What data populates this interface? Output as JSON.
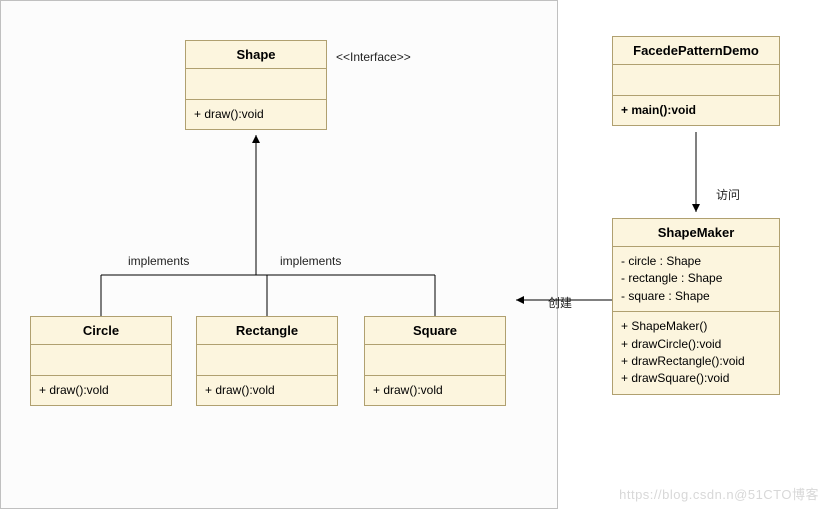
{
  "frame": {
    "present": true
  },
  "stereotype": "<<Interface>>",
  "classes": {
    "shape": {
      "name": "Shape",
      "methods": [
        "+ draw():void"
      ]
    },
    "circle": {
      "name": "Circle",
      "methods": [
        "+ draw():vold"
      ]
    },
    "rectangle": {
      "name": "Rectangle",
      "methods": [
        "+ draw():vold"
      ]
    },
    "square": {
      "name": "Square",
      "methods": [
        "+ draw():vold"
      ]
    },
    "demo": {
      "name": "FacedePatternDemo",
      "methods": [
        "+ main():void"
      ]
    },
    "maker": {
      "name": "ShapeMaker",
      "attrs": [
        "- circle : Shape",
        "- rectangle : Shape",
        "- square : Shape"
      ],
      "methods": [
        "+ ShapeMaker()",
        "+ drawCircle():void",
        "+ drawRectangle():void",
        "+ drawSquare():void"
      ]
    }
  },
  "labels": {
    "implements1": "implements",
    "implements2": "implements",
    "visit": "访问",
    "create": "创建"
  },
  "watermark": "https://blog.csdn.n@51CTO博客"
}
